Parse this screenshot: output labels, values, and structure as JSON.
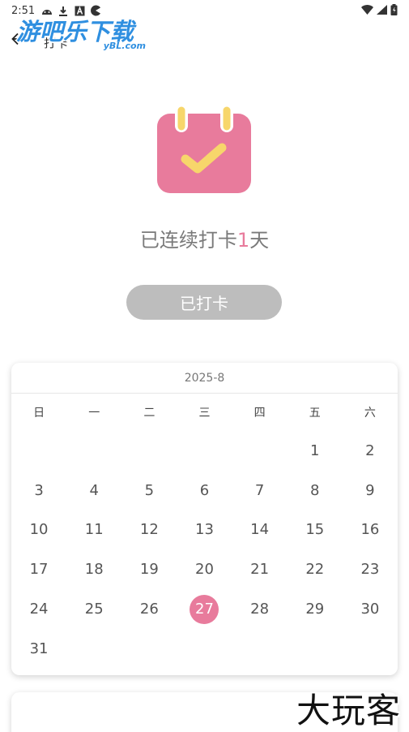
{
  "status_bar": {
    "time": "2:51"
  },
  "header": {
    "title": "打卡",
    "back_icon": "arrow-left-icon"
  },
  "watermark": {
    "logo_main": "游吧乐下载",
    "logo_sub": "yBL.com",
    "corner_text": "大玩客"
  },
  "hero": {
    "streak_prefix": "已连续打卡",
    "streak_count": "1",
    "streak_suffix": "天",
    "button_label": "已打卡"
  },
  "calendar": {
    "month_label": "2025-8",
    "weekdays": [
      "日",
      "一",
      "二",
      "三",
      "四",
      "五",
      "六"
    ],
    "selected_day": "27",
    "weeks": [
      [
        "",
        "",
        "",
        "",
        "",
        "1",
        "2"
      ],
      [
        "3",
        "4",
        "5",
        "6",
        "7",
        "8",
        "9"
      ],
      [
        "10",
        "11",
        "12",
        "13",
        "14",
        "15",
        "16"
      ],
      [
        "17",
        "18",
        "19",
        "20",
        "21",
        "22",
        "23"
      ],
      [
        "24",
        "25",
        "26",
        "27",
        "28",
        "29",
        "30"
      ],
      [
        "31",
        "",
        "",
        "",
        "",
        "",
        ""
      ]
    ]
  },
  "colors": {
    "accent_pink": "#e87b9c",
    "button_gray": "#bdbdbd",
    "calendar_icon_yellow": "#f7d66b"
  }
}
